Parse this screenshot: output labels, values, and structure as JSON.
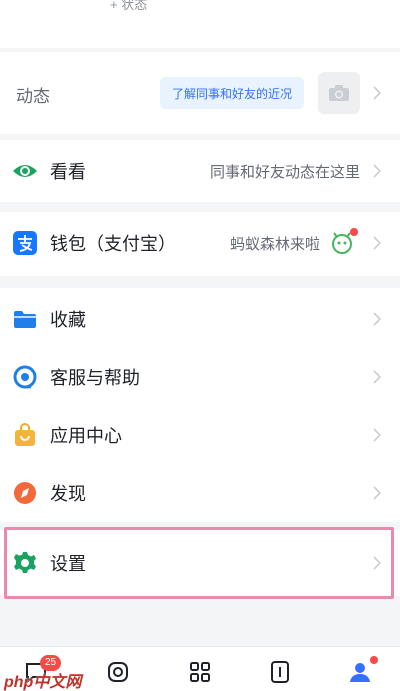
{
  "header": {
    "status_label": "+ 状态"
  },
  "moments": {
    "label": "动态",
    "pill_text": "了解同事和好友的近况",
    "camera_icon": "camera-icon"
  },
  "menu": {
    "kankan": {
      "label": "看看",
      "detail": "同事和好友动态在这里",
      "icon": "eye-icon"
    },
    "wallet": {
      "label": "钱包（支付宝）",
      "detail": "蚂蚁森林来啦",
      "icon": "alipay-icon"
    },
    "favorites": {
      "label": "收藏",
      "icon": "folder-icon"
    },
    "support": {
      "label": "客服与帮助",
      "icon": "headset-icon"
    },
    "apps": {
      "label": "应用中心",
      "icon": "bag-icon"
    },
    "discover": {
      "label": "发现",
      "icon": "compass-icon"
    },
    "settings": {
      "label": "设置",
      "icon": "gear-icon"
    }
  },
  "tabbar": {
    "messages_badge": "25",
    "tabs": [
      "chat-icon",
      "moments-tab-icon",
      "workbench-icon",
      "docs-icon",
      "me-icon"
    ]
  },
  "watermark": "php中文网",
  "colors": {
    "accent": "#3370ff",
    "highlight": "#e88aa8",
    "badge": "#f54a45"
  }
}
